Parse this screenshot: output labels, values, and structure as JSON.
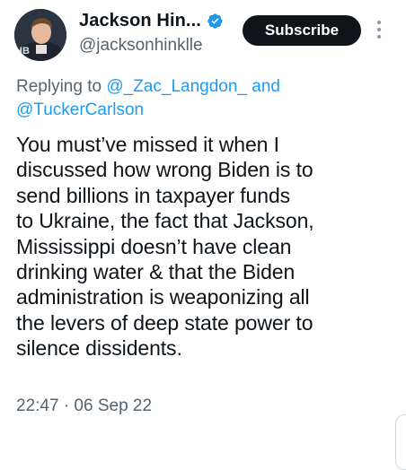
{
  "author": {
    "display_name": "Jackson Hin...",
    "handle": "@jacksonhinklle",
    "verified": true,
    "avatar_badge": "HB"
  },
  "actions": {
    "subscribe_label": "Subscribe",
    "more_icon": "more-vertical-icon"
  },
  "reply": {
    "prefix": "Replying to",
    "mention1": "@_Zac_Langdon_",
    "connector": "and",
    "mention2": "@TuckerCarlson"
  },
  "tweet": {
    "lines": [
      "You must’ve missed it when I",
      "discussed how wrong Biden is to",
      "send billions in taxpayer funds",
      "to Ukraine, the fact that Jackson,",
      "Mississippi doesn’t have clean",
      "drinking water & that the Biden",
      "administration is weaponizing all",
      "the levers of deep state power to",
      "silence dissidents."
    ]
  },
  "meta": {
    "timestamp": "22:47 · 06 Sep 22"
  },
  "colors": {
    "text": "#0f1419",
    "secondary": "#536471",
    "link": "#1d9bf0",
    "subscribe_bg": "#0f1419"
  }
}
